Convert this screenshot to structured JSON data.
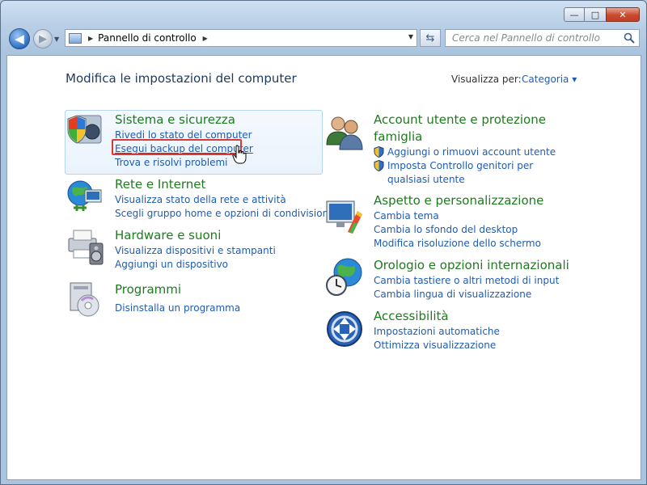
{
  "window": {
    "caption_buttons": {
      "minimize": "—",
      "maximize": "□",
      "close": "✕"
    }
  },
  "toolbar": {
    "breadcrumb": "Pannello di controllo",
    "search_placeholder": "Cerca nel Pannello di controllo"
  },
  "main": {
    "title": "Modifica le impostazioni del computer",
    "view_label": "Visualizza per:",
    "view_value": "Categoria ▾"
  },
  "left_categories": [
    {
      "title": "Sistema e sicurezza",
      "icon": "shield-pc-icon",
      "links": [
        "Rivedi lo stato del computer",
        "Esegui backup del computer",
        "Trova e risolvi problemi"
      ]
    },
    {
      "title": "Rete e Internet",
      "icon": "network-globe-icon",
      "links": [
        "Visualizza stato della rete e attività",
        "Scegli gruppo home e opzioni di condivisione"
      ]
    },
    {
      "title": "Hardware e suoni",
      "icon": "printer-speaker-icon",
      "links": [
        "Visualizza dispositivi e stampanti",
        "Aggiungi un dispositivo"
      ]
    },
    {
      "title": "Programmi",
      "icon": "programs-disc-icon",
      "links": [
        "Disinstalla un programma"
      ]
    }
  ],
  "right_categories": [
    {
      "title": "Account utente e protezione famiglia",
      "icon": "users-icon",
      "links": [
        "Aggiungi o rimuovi account utente",
        "Imposta Controllo genitori per qualsiasi utente"
      ]
    },
    {
      "title": "Aspetto e personalizzazione",
      "icon": "monitor-paint-icon",
      "links": [
        "Cambia tema",
        "Cambia lo sfondo del desktop",
        "Modifica risoluzione dello schermo"
      ]
    },
    {
      "title": "Orologio e opzioni internazionali",
      "icon": "globe-clock-icon",
      "links": [
        "Cambia tastiere o altri metodi di input",
        "Cambia lingua di visualizzazione"
      ]
    },
    {
      "title": "Accessibilità",
      "icon": "accessibility-icon",
      "links": [
        "Impostazioni automatiche",
        "Ottimizza visualizzazione"
      ]
    }
  ],
  "colors": {
    "category_title": "#1e7b1e",
    "link": "#1e5cb3",
    "highlight_border": "#d93a33"
  }
}
